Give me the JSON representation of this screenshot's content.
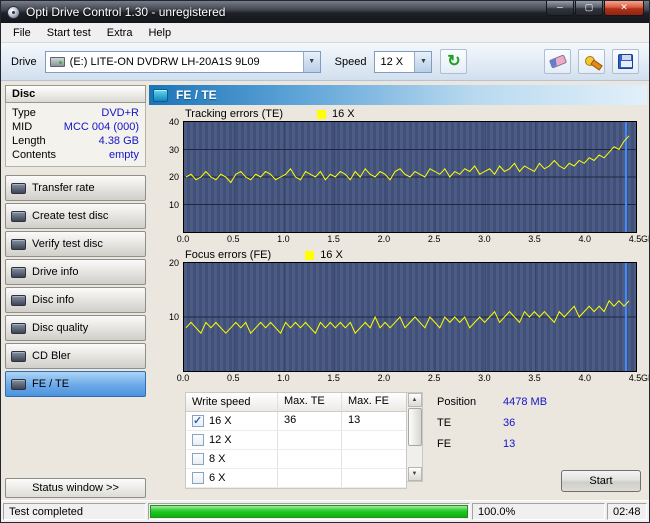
{
  "window": {
    "title": "Opti Drive Control 1.30 - unregistered"
  },
  "menu": {
    "items": [
      "File",
      "Start test",
      "Extra",
      "Help"
    ]
  },
  "toolbar": {
    "drive_label": "Drive",
    "drive_value": "(E:)   LITE-ON DVDRW LH-20A1S 9L09",
    "speed_label": "Speed",
    "speed_value": "12 X"
  },
  "sidebar": {
    "disc_header": "Disc",
    "disc_info": [
      {
        "label": "Type",
        "value": "DVD+R"
      },
      {
        "label": "MID",
        "value": "MCC 004 (000)"
      },
      {
        "label": "Length",
        "value": "4.38 GB"
      },
      {
        "label": "Contents",
        "value": "empty"
      }
    ],
    "nav": [
      {
        "label": "Transfer rate"
      },
      {
        "label": "Create test disc"
      },
      {
        "label": "Verify test disc"
      },
      {
        "label": "Drive info"
      },
      {
        "label": "Disc info"
      },
      {
        "label": "Disc quality"
      },
      {
        "label": "CD Bler"
      },
      {
        "label": "FE / TE",
        "active": true
      }
    ],
    "status_window_button": "Status window >>"
  },
  "main": {
    "header": "FE / TE",
    "results_table": {
      "columns": [
        "Write speed",
        "Max. TE",
        "Max. FE"
      ],
      "rows": [
        {
          "checked": true,
          "speed": "16 X",
          "max_te": "36",
          "max_fe": "13"
        },
        {
          "checked": false,
          "speed": "12 X",
          "max_te": "",
          "max_fe": ""
        },
        {
          "checked": false,
          "speed": "8 X",
          "max_te": "",
          "max_fe": ""
        },
        {
          "checked": false,
          "speed": "6 X",
          "max_te": "",
          "max_fe": ""
        }
      ]
    },
    "readout": {
      "position_label": "Position",
      "position_value": "4478 MB",
      "te_label": "TE",
      "te_value": "36",
      "fe_label": "FE",
      "fe_value": "13"
    },
    "start_button": "Start"
  },
  "statusbar": {
    "status": "Test completed",
    "percent": "100.0%",
    "time": "02:48",
    "progress": 100
  },
  "chart_data": [
    {
      "type": "line",
      "title": "Tracking errors (TE)",
      "legend": "16 X",
      "series_color": "#ffff00",
      "cursor_color": "#3f8cff",
      "xlim": [
        0,
        4.5
      ],
      "ylim": [
        0,
        40
      ],
      "xticks": [
        0,
        0.5,
        1.0,
        1.5,
        2.0,
        2.5,
        3.0,
        3.5,
        4.0,
        4.5
      ],
      "yticks": [
        10,
        20,
        30,
        40
      ],
      "xunit": "GB",
      "x_start": 0.02,
      "x_end": 4.43,
      "cursor_x": 4.4,
      "values": [
        20,
        21,
        19,
        20,
        22,
        20,
        19,
        21,
        20,
        18,
        21,
        22,
        20,
        19,
        21,
        20,
        22,
        21,
        19,
        20,
        21,
        23,
        20,
        19,
        22,
        21,
        20,
        22,
        19,
        21,
        20,
        22,
        21,
        19,
        22,
        20,
        23,
        21,
        20,
        22,
        21,
        19,
        22,
        23,
        21,
        20,
        22,
        21,
        20,
        23,
        22,
        21,
        23,
        20,
        22,
        21,
        23,
        22,
        24,
        21,
        22,
        23,
        21,
        24,
        22,
        23,
        25,
        22,
        24,
        23,
        22,
        25,
        23,
        24,
        26,
        24,
        23,
        25,
        24,
        26,
        25,
        27,
        26,
        28,
        27,
        29,
        31,
        30,
        33,
        35
      ]
    },
    {
      "type": "line",
      "title": "Focus errors (FE)",
      "legend": "16 X",
      "series_color": "#ffff00",
      "cursor_color": "#3f8cff",
      "xlim": [
        0,
        4.5
      ],
      "ylim": [
        0,
        20
      ],
      "xticks": [
        0,
        0.5,
        1.0,
        1.5,
        2.0,
        2.5,
        3.0,
        3.5,
        4.0,
        4.5
      ],
      "yticks": [
        10,
        20
      ],
      "xunit": "GB",
      "x_start": 0.02,
      "x_end": 4.43,
      "cursor_x": 4.4,
      "values": [
        8,
        9,
        8,
        7,
        9,
        8,
        9,
        8,
        7,
        8,
        9,
        8,
        9,
        7,
        8,
        9,
        8,
        9,
        8,
        7,
        9,
        8,
        9,
        8,
        9,
        8,
        7,
        9,
        8,
        9,
        8,
        9,
        8,
        9,
        7,
        8,
        9,
        8,
        10,
        8,
        9,
        8,
        9,
        10,
        8,
        9,
        10,
        9,
        8,
        10,
        9,
        8,
        10,
        9,
        10,
        9,
        10,
        8,
        9,
        10,
        9,
        10,
        11,
        9,
        10,
        11,
        10,
        9,
        11,
        10,
        11,
        10,
        11,
        10,
        9,
        11,
        10,
        11,
        12,
        10,
        11,
        12,
        11,
        12,
        11,
        13,
        12,
        13,
        12,
        13
      ]
    }
  ]
}
